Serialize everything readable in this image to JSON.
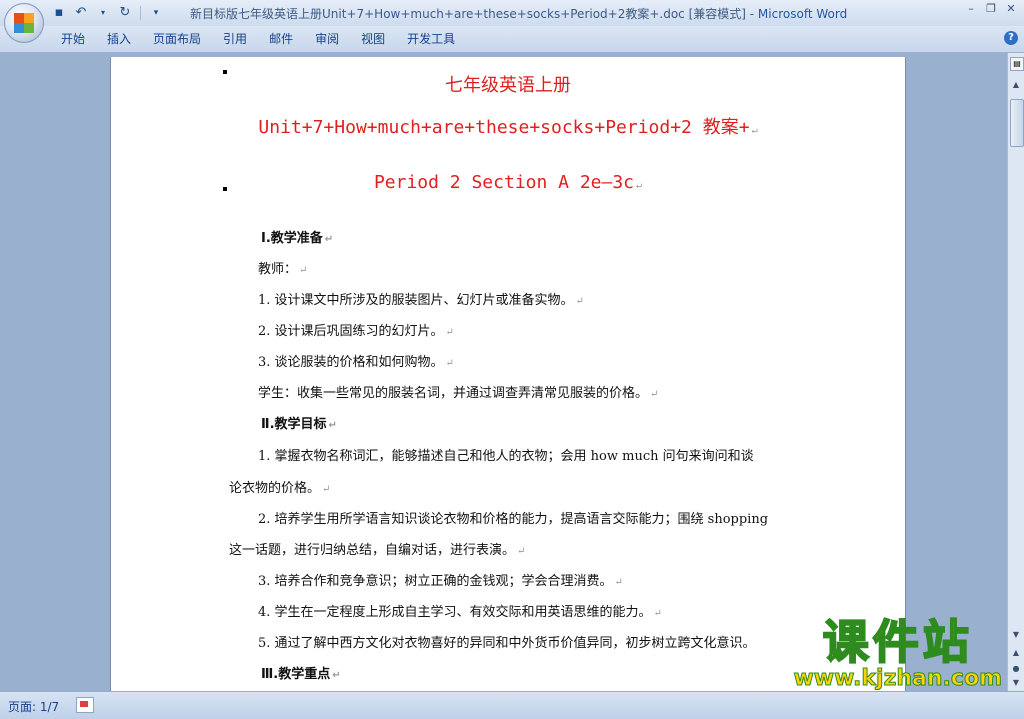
{
  "window": {
    "title_doc": "新目标版七年级英语上册Unit+7+How+much+are+these+socks+Period+2教案+.doc [兼容模式] - ",
    "title_app": "Microsoft Word"
  },
  "quick_access": {
    "icons": [
      "save-icon",
      "undo-icon",
      "redo-icon",
      "customize-icon"
    ]
  },
  "ribbon": {
    "tabs": [
      "开始",
      "插入",
      "页面布局",
      "引用",
      "邮件",
      "审阅",
      "视图",
      "开发工具"
    ],
    "help": "?"
  },
  "document": {
    "title1": "七年级英语上册",
    "title2": "Unit+7+How+much+are+these+socks+Period+2 教案+",
    "title3": "Period 2  Section A 2e—3c",
    "paragraphs": [
      "Ⅰ.教学准备",
      "教师：",
      "1. 设计课文中所涉及的服装图片、幻灯片或准备实物。",
      "2. 设计课后巩固练习的幻灯片。",
      "3. 谈论服装的价格和如何购物。",
      "学生：收集一些常见的服装名词，并通过调查弄清常见服装的价格。",
      "Ⅱ.教学目标",
      "1. 掌握衣物名称词汇，能够描述自己和他人的衣物；会用 how  much 问句来询问和谈",
      "论衣物的价格。",
      "2. 培养学生用所学语言知识谈论衣物和价格的能力，提高语言交际能力；围绕 shopping",
      "这一话题，进行归纳总结，自编对话，进行表演。",
      "3. 培养合作和竞争意识；树立正确的金钱观；学会合理消费。",
      "4. 学生在一定程度上形成自主学习、有效交际和用英语思维的能力。",
      "5. 通过了解中西方文化对衣物喜好的异同和中外货币价值异同，初步树立跨文化意识。",
      "Ⅲ.教学重点"
    ]
  },
  "status": {
    "page": "页面: 1/7"
  },
  "watermark": {
    "text": "课件站",
    "url": "www.kjzhan.com"
  },
  "colors": {
    "title_red": "#e02020",
    "word_blue": "#2456a4"
  }
}
